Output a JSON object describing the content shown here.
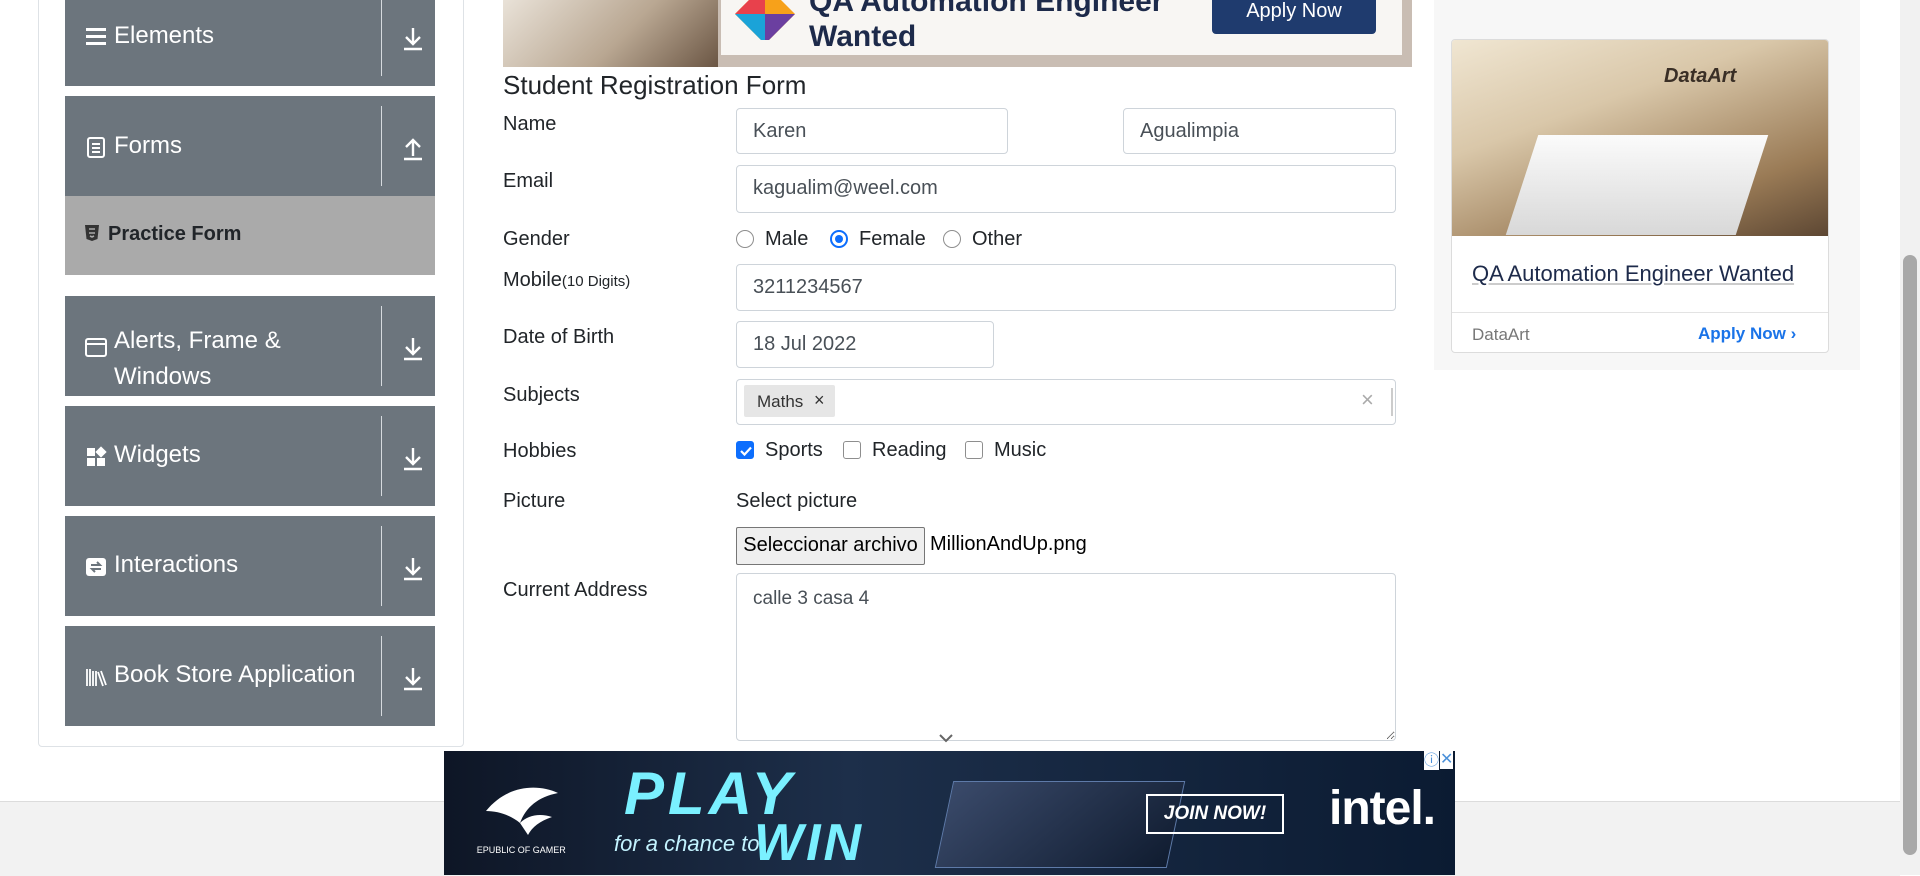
{
  "sidebar": {
    "groups": [
      {
        "label": "Elements",
        "icon": "menu-icon"
      },
      {
        "label": "Forms",
        "icon": "form-icon"
      },
      {
        "label": "Alerts, Frame & Windows",
        "icon": "window-icon"
      },
      {
        "label": "Widgets",
        "icon": "widgets-icon"
      },
      {
        "label": "Interactions",
        "icon": "interactions-icon"
      },
      {
        "label": "Book Store Application",
        "icon": "books-icon"
      }
    ],
    "active_item": "Practice Form"
  },
  "top_ad": {
    "headline": "QA Automation Engineer Wanted",
    "button": "Apply Now"
  },
  "form": {
    "title": "Student Registration Form",
    "name_label": "Name",
    "first_name": "Karen",
    "last_name": "Agualimpia",
    "email_label": "Email",
    "email": "kagualim@weel.com",
    "gender_label": "Gender",
    "genders": [
      "Male",
      "Female",
      "Other"
    ],
    "gender_selected": "Female",
    "mobile_label": "Mobile",
    "mobile_hint": "(10 Digits)",
    "mobile": "3211234567",
    "dob_label": "Date of Birth",
    "dob": "18 Jul 2022",
    "subjects_label": "Subjects",
    "subjects": [
      "Maths"
    ],
    "hobbies_label": "Hobbies",
    "hobbies": [
      {
        "label": "Sports",
        "checked": true
      },
      {
        "label": "Reading",
        "checked": false
      },
      {
        "label": "Music",
        "checked": false
      }
    ],
    "picture_label": "Picture",
    "select_picture": "Select picture",
    "file_button": "Seleccionar archivo",
    "file_name": "MillionAndUp.png",
    "address_label": "Current Address",
    "address": "calle 3 casa 4"
  },
  "right_ad": {
    "brand": "DataArt",
    "headline": "QA Automation Engineer Wanted",
    "advertiser": "DataArt",
    "cta": "Apply Now"
  },
  "bottom_ad": {
    "brand_small": "REPUBLIC OF GAMERS",
    "play": "PLAY",
    "chance": "for a chance to",
    "win": "WIN",
    "join": "JOIN NOW!",
    "sponsor": "intel."
  },
  "colors": {
    "sidebar_bg": "#6c757d",
    "active_bg": "#aaaaaa",
    "accent": "#0d6efd"
  }
}
